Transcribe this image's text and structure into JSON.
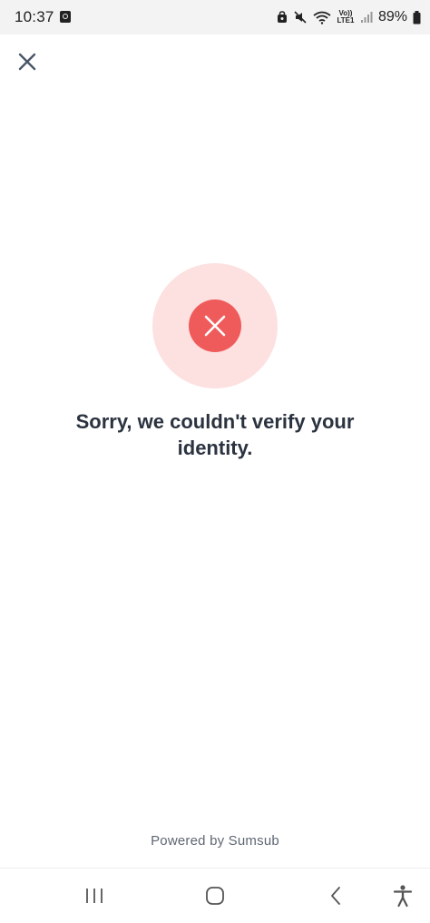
{
  "status_bar": {
    "time": "10:37",
    "battery_percent": "89%",
    "volte_label_top": "Vo))",
    "volte_label_bottom": "LTE1"
  },
  "header": {
    "close_icon": "close-icon"
  },
  "result": {
    "icon": "error-x-icon",
    "message": "Sorry, we couldn't verify your identity.",
    "colors": {
      "halo": "#fde0e0",
      "circle": "#ef5b5b",
      "text": "#2b3340"
    }
  },
  "footer": {
    "powered_by": "Powered by Sumsub"
  },
  "nav": {
    "recents_icon": "recents-icon",
    "home_icon": "home-icon",
    "back_icon": "back-icon",
    "accessibility_icon": "accessibility-icon"
  }
}
